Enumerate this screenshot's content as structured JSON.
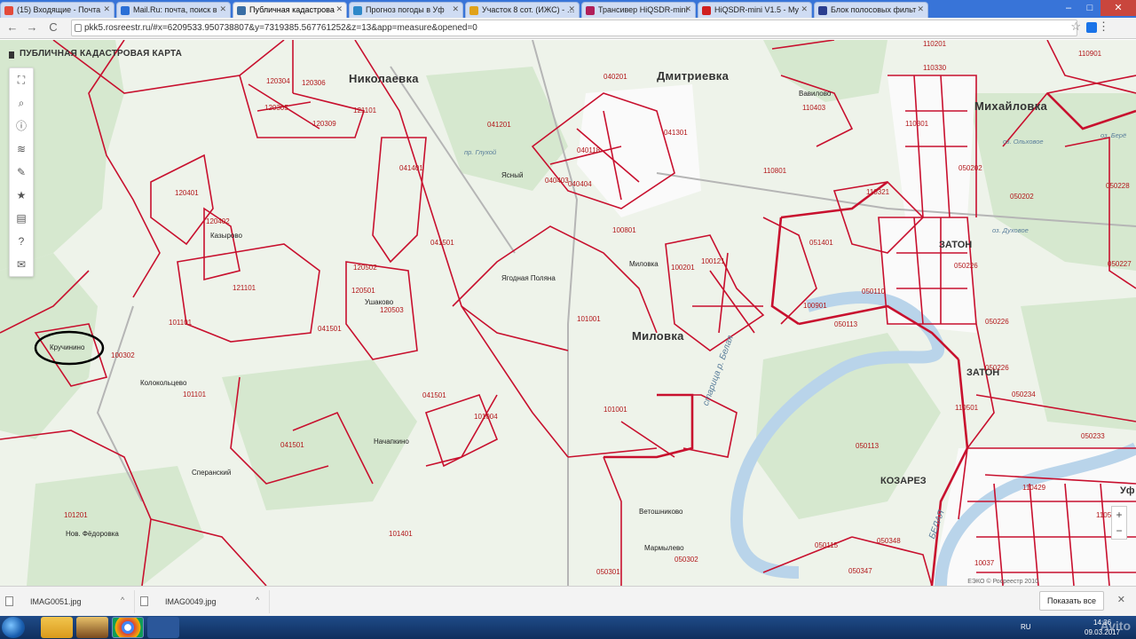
{
  "browser": {
    "tabs": [
      {
        "title": "(15) Входящие - Почта",
        "color": "#e34a3a"
      },
      {
        "title": "Mail.Ru: почта, поиск в",
        "color": "#2a6fd6"
      },
      {
        "title": "Публичная кадастрова",
        "color": "#3a6ea5"
      },
      {
        "title": "Прогноз погоды в Уф",
        "color": "#2e88c9"
      },
      {
        "title": "Участок 8 сот. (ИЖС) - …",
        "color": "#e0a21a"
      },
      {
        "title": "Трансивер HiQSDR-mini",
        "color": "#b01f5a"
      },
      {
        "title": "HiQSDR-mini V1.5 - My",
        "color": "#d02020"
      },
      {
        "title": "Блок полосовых фильт",
        "color": "#2b3e8f"
      }
    ],
    "active_tab": 2,
    "url": "pkk5.rosreestr.ru/#x=6209533.950738807&y=7319385.567761252&z=13&app=measure&opened=0",
    "nav": {
      "back": "←",
      "forward": "→",
      "reload": "C",
      "star": "☆",
      "menu": "⋮"
    },
    "window_buttons": {
      "minimize": "–",
      "maximize": "□",
      "close": "✕"
    }
  },
  "map": {
    "title": "ПУБЛИЧНАЯ КАДАСТРОВАЯ КАРТА",
    "tools": [
      {
        "icon": "pin-icon",
        "glyph": "⛶"
      },
      {
        "icon": "search-icon",
        "glyph": "⌕"
      },
      {
        "icon": "info-icon",
        "glyph": "ⓘ"
      },
      {
        "icon": "layers-icon",
        "glyph": "≋"
      },
      {
        "icon": "pencil-icon",
        "glyph": "✎"
      },
      {
        "icon": "star-icon",
        "glyph": "★"
      },
      {
        "icon": "print-icon",
        "glyph": "▤"
      },
      {
        "icon": "help-icon",
        "glyph": "?"
      },
      {
        "icon": "mail-icon",
        "glyph": "✉"
      }
    ],
    "zoom": {
      "plus": "+",
      "minus": "−"
    },
    "copyright": "ЕЭКО © Росреестр 2010",
    "places": [
      {
        "text": "Николаевка",
        "cls": "big"
      },
      {
        "text": "Дмитриевка",
        "cls": "big"
      },
      {
        "text": "Михайловка",
        "cls": "big"
      },
      {
        "text": "Миловка",
        "cls": "big"
      },
      {
        "text": "ЗАТОН",
        "cls": "mid"
      },
      {
        "text": "ЗАТОН",
        "cls": "mid"
      },
      {
        "text": "КОЗАРЕЗ",
        "cls": "mid"
      },
      {
        "text": "Вавилово",
        "cls": ""
      },
      {
        "text": "Ясный",
        "cls": ""
      },
      {
        "text": "Миловка",
        "cls": ""
      },
      {
        "text": "Ягодная Поляна",
        "cls": ""
      },
      {
        "text": "Казырово",
        "cls": ""
      },
      {
        "text": "Ушаково",
        "cls": ""
      },
      {
        "text": "Кручинино",
        "cls": ""
      },
      {
        "text": "Колокольцево",
        "cls": ""
      },
      {
        "text": "Начапкино",
        "cls": ""
      },
      {
        "text": "Сперанский",
        "cls": ""
      },
      {
        "text": "Нов. Фёдоровка",
        "cls": ""
      },
      {
        "text": "Ветошниково",
        "cls": ""
      },
      {
        "text": "Мармылево",
        "cls": ""
      },
      {
        "text": "Уф",
        "cls": "mid"
      },
      {
        "text": "пр. Глухой",
        "cls": "water"
      },
      {
        "text": "оз. Ольховое",
        "cls": "water"
      },
      {
        "text": "оз. Духовое",
        "cls": "water"
      },
      {
        "text": "оз. Берё",
        "cls": "water"
      },
      {
        "text": "старица р. Белая",
        "cls": "river"
      },
      {
        "text": "БЕЛАЯ",
        "cls": "river"
      }
    ],
    "codes": [
      "120304",
      "120306",
      "120305",
      "120309",
      "121101",
      "041201",
      "041401",
      "041501",
      "120401",
      "120402",
      "121101",
      "120502",
      "120501",
      "120503",
      "041501",
      "101101",
      "041501",
      "100302",
      "101101",
      "041501",
      "101004",
      "101201",
      "101401",
      "040201",
      "040118",
      "040404",
      "040403",
      "041301",
      "100801",
      "100201",
      "100121",
      "101001",
      "101001",
      "100901",
      "110201",
      "110403",
      "110801",
      "110301",
      "110321",
      "050202",
      "050202",
      "051401",
      "050110",
      "050113",
      "050226",
      "050226",
      "050234",
      "050226",
      "110501",
      "050233",
      "050113",
      "050348",
      "050302",
      "050301",
      "050347",
      "050115",
      "110429",
      "050227",
      "110901",
      "110330",
      "050228",
      "10037",
      "1105"
    ]
  },
  "downloads": {
    "items": [
      "IMAG0051.jpg",
      "IMAG0049.jpg"
    ],
    "show_all": "Показать все",
    "close": "✕"
  },
  "taskbar": {
    "lang": "RU",
    "time": "14:36",
    "date": "09.03.2017",
    "watermark": "Avito"
  }
}
